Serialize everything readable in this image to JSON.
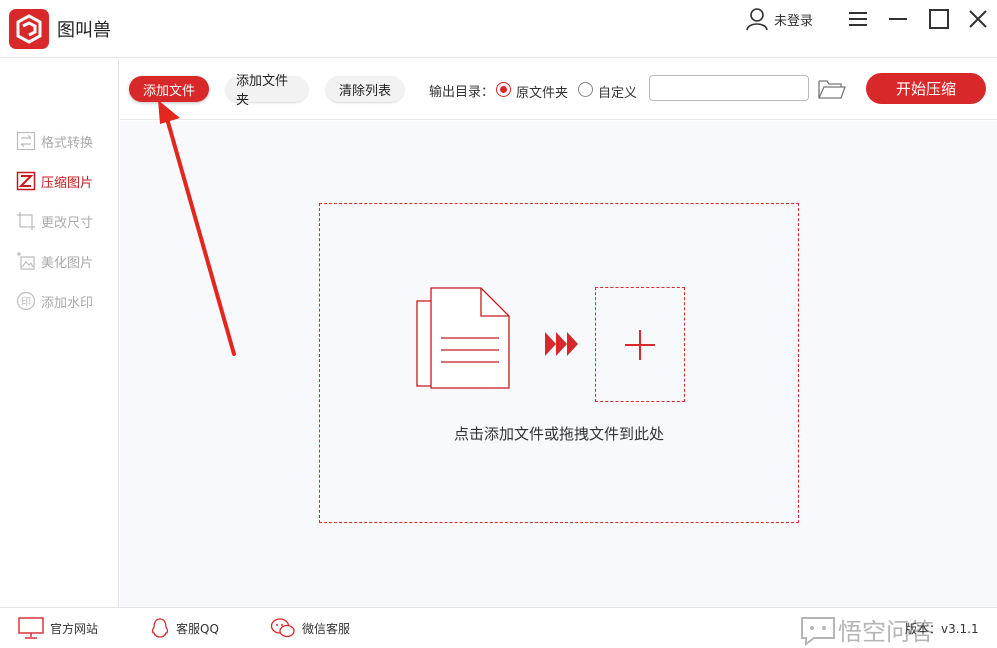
{
  "app": {
    "title": "图叫兽",
    "user_label": "未登录"
  },
  "sidebar": {
    "items": [
      {
        "label": "格式转换",
        "icon": "swap-icon"
      },
      {
        "label": "压缩图片",
        "icon": "compress-icon",
        "active": true
      },
      {
        "label": "更改尺寸",
        "icon": "resize-icon"
      },
      {
        "label": "美化图片",
        "icon": "beautify-icon"
      },
      {
        "label": "添加水印",
        "icon": "watermark-icon"
      }
    ]
  },
  "toolbar": {
    "add_file": "添加文件",
    "add_folder": "添加文件夹",
    "clear_list": "清除列表",
    "output_label": "输出目录：",
    "option_original": "原文件夹",
    "option_custom": "自定义",
    "path_value": "",
    "start": "开始压缩"
  },
  "main": {
    "drop_hint": "点击添加文件或拖拽文件到此处"
  },
  "footer": {
    "website": "官方网站",
    "qq": "客服QQ",
    "wechat": "微信客服",
    "version": "版本：v3.1.1",
    "watermark_text": "悟空问答"
  },
  "colors": {
    "accent": "#d8282a",
    "sidebar_inactive": "#aaaaaa",
    "main_bg": "#f7f9fc"
  }
}
